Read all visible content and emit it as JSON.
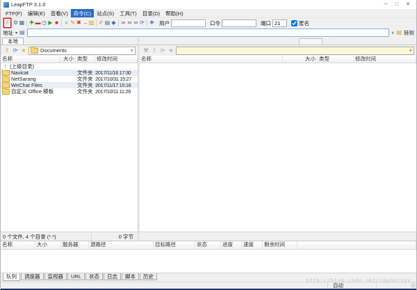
{
  "window": {
    "title": "LeapFTP 3.1.0",
    "controls": {
      "minimize": "─",
      "maximize": "□",
      "close": "✕"
    }
  },
  "menu": {
    "items": [
      {
        "id": "ftp",
        "label": "FTP(F)"
      },
      {
        "id": "edit",
        "label": "编辑(E)"
      },
      {
        "id": "view",
        "label": "查看(V)"
      },
      {
        "id": "command",
        "label": "命令(C)",
        "active": true
      },
      {
        "id": "site",
        "label": "站点(S)"
      },
      {
        "id": "tools",
        "label": "工具(T)"
      },
      {
        "id": "directory",
        "label": "目录(D)"
      },
      {
        "id": "help",
        "label": "帮助(H)"
      }
    ]
  },
  "toolbar": {
    "icons": [
      {
        "name": "connect",
        "glyph": "⚡",
        "color": "#d88a00",
        "boxed": true
      },
      {
        "name": "settings",
        "glyph": "⚙",
        "color": "#3a6ea5"
      },
      {
        "name": "site-manager",
        "glyph": "▦",
        "color": "#3a6ea5"
      },
      {
        "name": "sep"
      },
      {
        "name": "queue-add",
        "glyph": "✚",
        "color": "#2e9e2e"
      },
      {
        "name": "queue-remove",
        "glyph": "▬",
        "color": "#cc3333"
      },
      {
        "name": "schedule",
        "glyph": "◷",
        "color": "#3a6ea5"
      },
      {
        "name": "transfer-start",
        "glyph": "▶",
        "color": "#2e9e2e"
      },
      {
        "name": "transfer-stop",
        "glyph": "■",
        "color": "#cc3333"
      },
      {
        "name": "sep"
      },
      {
        "name": "view-file",
        "glyph": "⌕",
        "color": "#3a6ea5"
      },
      {
        "name": "edit-file",
        "glyph": "✎",
        "color": "#d88a00"
      },
      {
        "name": "delete-file",
        "glyph": "✖",
        "color": "#cc3333"
      },
      {
        "name": "move-file",
        "glyph": "→",
        "color": "#3a6ea5"
      },
      {
        "name": "make-directory",
        "glyph": "▨",
        "color": "#d4a017"
      },
      {
        "name": "sep"
      },
      {
        "name": "rename",
        "glyph": "✐",
        "color": "#d88a00"
      },
      {
        "name": "file-properties",
        "glyph": "▤",
        "color": "#3a6ea5"
      },
      {
        "name": "sync",
        "glyph": "◆",
        "color": "#2e6dd0"
      },
      {
        "name": "sep"
      },
      {
        "name": "find",
        "glyph": "∞",
        "color": "#445"
      },
      {
        "name": "find-next",
        "glyph": "∞",
        "color": "#445"
      },
      {
        "name": "find-again",
        "glyph": "∞",
        "color": "#445"
      },
      {
        "name": "refresh-list",
        "glyph": "⟳",
        "color": "#2e6dd0"
      },
      {
        "name": "sep"
      },
      {
        "name": "quick-connect",
        "glyph": "❖",
        "color": "#2e6dd0"
      }
    ],
    "user_label": "用户",
    "user_value": "",
    "password_label": "口令",
    "password_value": "",
    "port_label": "端口",
    "port_value": "21",
    "anonymous_label": "匿名",
    "anonymous_checked": true
  },
  "addressbar": {
    "label": "地址",
    "value": "",
    "go_label": "转到"
  },
  "local_panel": {
    "tab": "本地",
    "mini_icons": [
      {
        "name": "up-directory",
        "glyph": "⇧",
        "color": "#d4a017"
      },
      {
        "name": "refresh",
        "glyph": "⟳",
        "color": "#2e6dd0"
      },
      {
        "name": "favorites",
        "glyph": "★",
        "color": "#e8b800"
      }
    ],
    "path": "Documents",
    "columns": [
      "名称",
      "大小",
      "类型",
      "修改时间"
    ],
    "parent_row": "(上级目录)",
    "rows": [
      {
        "name": "Navicat",
        "size": "",
        "type": "文件夹",
        "modified": "2017/11/16 17:30"
      },
      {
        "name": "NetSarang",
        "size": "",
        "type": "文件夹",
        "modified": "2017/10/31 15:27"
      },
      {
        "name": "WeChat Files",
        "size": "",
        "type": "文件夹",
        "modified": "2017/11/17 15:16"
      },
      {
        "name": "自定义 Office 模板",
        "size": "",
        "type": "文件夹",
        "modified": "2017/10/11 11:29"
      }
    ],
    "status_left": "0 个文件, 4 个目录 (*.*)",
    "status_right": "0 字节"
  },
  "remote_panel": {
    "mini_icons": [
      {
        "name": "transfer-tools",
        "glyph": "⚒",
        "color": "#8a97a5"
      },
      {
        "name": "up-directory",
        "glyph": "⇧",
        "color": "#9aa3ad"
      },
      {
        "name": "refresh",
        "glyph": "⟳",
        "color": "#9aa3ad"
      },
      {
        "name": "favorites",
        "glyph": "★",
        "color": "#b8b29a"
      }
    ],
    "path": "",
    "columns": [
      "名称",
      "大小",
      "类型",
      "修改时间"
    ]
  },
  "queue_panel": {
    "columns": [
      "名称",
      "大小",
      "服务器",
      "源路径",
      "目标路径",
      "状态",
      "进度",
      "速度",
      "剩余时间"
    ]
  },
  "bottom_tabs": [
    "队列",
    "调度器",
    "监视器",
    "URL",
    "状态",
    "日志",
    "脚本",
    "历史"
  ],
  "statusbar": {
    "mode": "自动"
  },
  "watermark": "http://blog.csdn.net/raynorxyx",
  "colors": {
    "menu_active": "#2a6cc4",
    "annotation_box": "#e02020",
    "remote_combo_bg": "#fcf7d6",
    "row_shade": "#e9edf4",
    "bottom_edge": "#20386b",
    "folder_icon": "#f7d673"
  }
}
